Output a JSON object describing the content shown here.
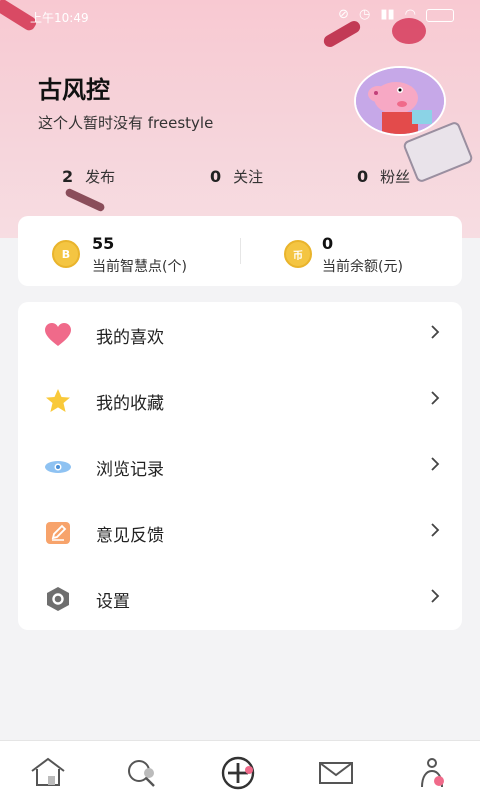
{
  "status_bar": {
    "time": "上午10:49"
  },
  "profile": {
    "name": "古风控",
    "bio": "这个人暂时没有 freestyle",
    "stats": [
      {
        "count": "2",
        "label": "发布"
      },
      {
        "count": "0",
        "label": "关注"
      },
      {
        "count": "0",
        "label": "粉丝"
      }
    ]
  },
  "wallet": {
    "points_value": "55",
    "points_label": "当前智慧点(个)",
    "points_coin": "B",
    "balance_value": "0",
    "balance_label": "当前余额(元)",
    "balance_coin": "币"
  },
  "menu": {
    "items": [
      {
        "label": "我的喜欢",
        "icon": "heart-icon"
      },
      {
        "label": "我的收藏",
        "icon": "star-icon"
      },
      {
        "label": "浏览记录",
        "icon": "eye-icon"
      },
      {
        "label": "意见反馈",
        "icon": "edit-icon"
      },
      {
        "label": "设置",
        "icon": "hexagon-settings-icon"
      }
    ]
  },
  "tabbar": {
    "items": [
      "home-icon",
      "search-icon",
      "add-icon",
      "message-icon",
      "profile-icon"
    ]
  },
  "colors": {
    "header_pink": "#f8c9d2",
    "heart": "#f06a8a",
    "star": "#f9c93a",
    "eye": "#5aa6e8",
    "edit": "#f7a36b",
    "settings": "#6e6e6e",
    "coin": "#f4c542",
    "tab_dot": "#f06a8a"
  }
}
